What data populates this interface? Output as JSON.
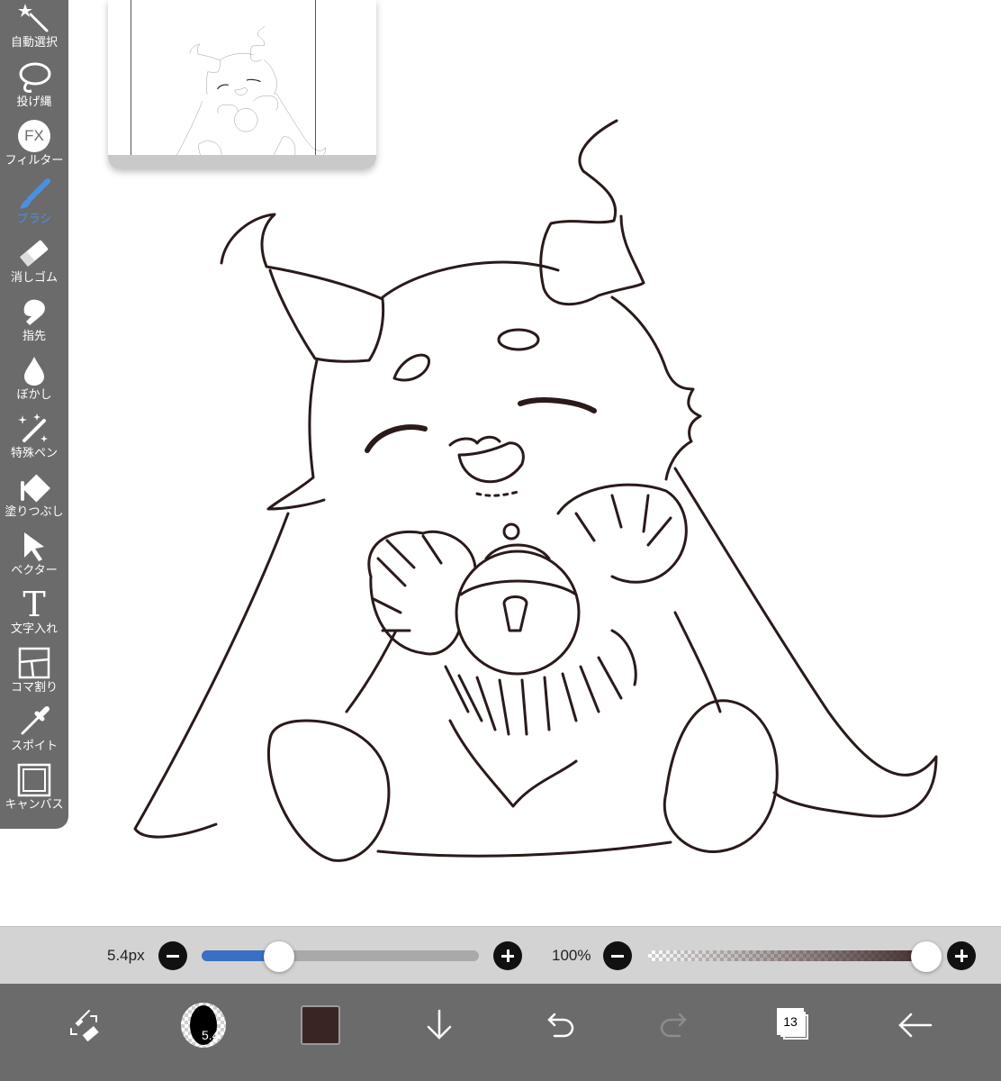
{
  "toolbar": {
    "items": [
      {
        "label": "自動選択",
        "icon": "magic-wand-icon"
      },
      {
        "label": "投げ縄",
        "icon": "lasso-icon"
      },
      {
        "label": "フィルター",
        "icon": "fx-icon",
        "icon_text": "FX"
      },
      {
        "label": "ブラシ",
        "icon": "brush-icon",
        "active": true
      },
      {
        "label": "消しゴム",
        "icon": "eraser-icon"
      },
      {
        "label": "指先",
        "icon": "smudge-icon"
      },
      {
        "label": "ぼかし",
        "icon": "blur-drop-icon"
      },
      {
        "label": "特殊ペン",
        "icon": "special-pen-icon"
      },
      {
        "label": "塗りつぶし",
        "icon": "bucket-fill-icon"
      },
      {
        "label": "ベクター",
        "icon": "vector-cursor-icon"
      },
      {
        "label": "文字入れ",
        "icon": "text-icon",
        "icon_text": "T"
      },
      {
        "label": "コマ割り",
        "icon": "frame-divider-icon"
      },
      {
        "label": "スポイト",
        "icon": "eyedropper-icon"
      },
      {
        "label": "キャンバス",
        "icon": "canvas-icon"
      }
    ]
  },
  "sliders": {
    "brush_size": {
      "value_text": "5.4px",
      "level": 0.28,
      "color": "#3b6fc4"
    },
    "opacity": {
      "value_text": "100%",
      "level": 1.0
    }
  },
  "action_bar": {
    "brush_preview_text": "5.4",
    "current_color": "#3a2525",
    "layer_count": "13",
    "items": [
      "swap-tool-icon",
      "brush-size-preview",
      "color-swatch",
      "download-icon",
      "undo-icon",
      "redo-icon",
      "layers-icon",
      "back-icon"
    ]
  },
  "colors": {
    "toolbar_bg": "#6b6b6b",
    "active_tool": "#4a90e2",
    "line_art": "#2a1a1a"
  }
}
